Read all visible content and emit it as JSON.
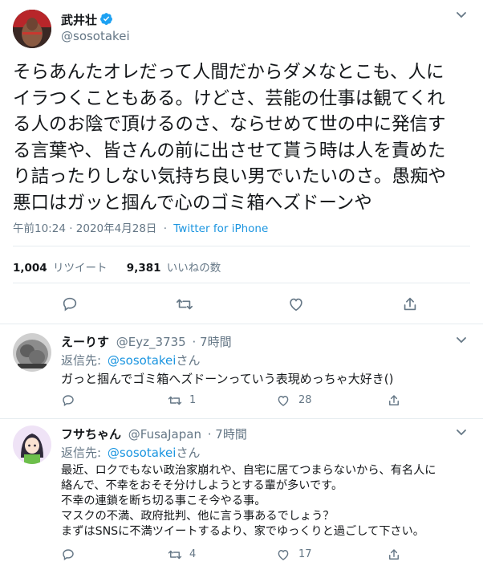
{
  "main_tweet": {
    "display_name": "武井壮",
    "handle": "@sosotakei",
    "text_lines": [
      "そらあんたオレだって人間だからダメなとこも、人に",
      "イラつくこともある。けどさ、芸能の仕事は観てくれ",
      "る人のお陰で頂けるのさ、ならせめて世の中に発信す",
      "る言葉や、皆さんの前に出させて貰う時は人を責めた",
      "り詰ったりしない気持ち良い男でいたいのさ。愚痴や",
      "悪口はガッと掴んで心のゴミ箱へズドーンや"
    ],
    "timestamp": "午前10:24 · 2020年4月28日",
    "dot": "·",
    "source": "Twitter for iPhone",
    "retweet_count": "1,004",
    "retweet_label": "リツイート",
    "like_count": "9,381",
    "like_label": "いいねの数"
  },
  "replies": [
    {
      "display_name": "えーりす",
      "handle": "@Eyz_3735",
      "time": "· 7時間",
      "replying_label": "返信先:",
      "replying_handle": "@sosotakei",
      "replying_suffix": "さん",
      "text_lines": [
        "ガっと掴んでゴミ箱へズドーンっていう表現めっちゃ大好き()"
      ],
      "retweets": "1",
      "likes": "28"
    },
    {
      "display_name": "フサちゃん",
      "handle": "@FusaJapan",
      "time": "· 7時間",
      "replying_label": "返信先:",
      "replying_handle": "@sosotakei",
      "replying_suffix": "さん",
      "text_lines": [
        "最近、ロクでもない政治家崩れや、自宅に居てつまらないから、有名人に",
        "絡んで、不幸をおそそ分けしようとする輩が多いです。",
        "不幸の連鎖を断ち切る事こそ今やる事。",
        "マスクの不満、政府批判、他に言う事あるでしょう？",
        "まずはSNSに不満ツイートするより、家でゆっくりと過ごして下さい。"
      ],
      "retweets": "4",
      "likes": "17"
    }
  ],
  "colors": {
    "accent": "#1b95e0",
    "muted": "#657786",
    "text": "#14171a",
    "divider": "#e6ecf0"
  }
}
